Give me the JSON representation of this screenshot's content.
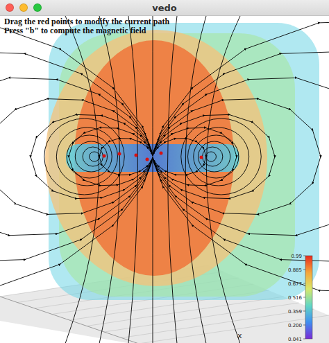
{
  "window": {
    "title": "vedo"
  },
  "instructions": [
    "Drag the red points to modify the current path",
    "Press \"b\" to compute the magnetic field"
  ],
  "colorbar": {
    "ticks": [
      "0.99",
      "0.885",
      "0.677",
      "0.516",
      "0.359",
      "0.200",
      "0.041"
    ]
  },
  "axis_labels": [
    "x"
  ]
}
